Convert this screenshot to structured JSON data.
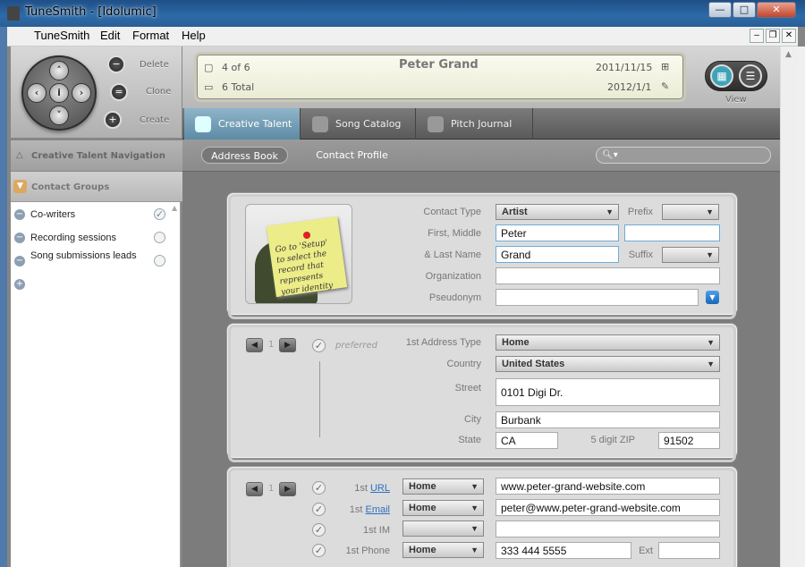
{
  "window": {
    "title": "TuneSmith - [Idolumic]",
    "minimize": "—",
    "maximize": "□",
    "close": "✕"
  },
  "menu": {
    "items": [
      "TuneSmith",
      "Edit",
      "Format",
      "Help"
    ]
  },
  "toolbar": {
    "delete": "Delete",
    "clone": "Clone",
    "create": "Create",
    "view": "View"
  },
  "record_header": {
    "position": "4 of 6",
    "total": "6 Total",
    "name": "Peter Grand",
    "date_created": "2011/11/15",
    "date_modified": "2012/1/1"
  },
  "tabs": [
    {
      "label": "Creative Talent",
      "active": true
    },
    {
      "label": "Song Catalog",
      "active": false
    },
    {
      "label": "Pitch Journal",
      "active": false
    }
  ],
  "left_panel": {
    "navigation_title": "Creative Talent Navigation",
    "groups_title": "Contact Groups",
    "groups": [
      {
        "label": "Co-writers",
        "checked": true
      },
      {
        "label": "Recording sessions",
        "checked": false
      },
      {
        "label": "Song submissions leads",
        "checked": false
      }
    ]
  },
  "subnav": {
    "address_book": "Address Book",
    "contact_profile": "Contact Profile",
    "search_placeholder": ""
  },
  "contact": {
    "photo_note": "Go to 'Setup' to select the record that represents your identity",
    "labels": {
      "contact_type": "Contact Type",
      "first_middle": "First, Middle",
      "last_name": "& Last Name",
      "organization": "Organization",
      "pseudonym": "Pseudonym",
      "prefix": "Prefix",
      "suffix": "Suffix"
    },
    "contact_type": "Artist",
    "first": "Peter",
    "middle": "",
    "last": "Grand",
    "organization": "",
    "pseudonym": ""
  },
  "address": {
    "index": "1",
    "preferred_label": "preferred",
    "labels": {
      "type": "1st Address Type",
      "country": "Country",
      "street": "Street",
      "city": "City",
      "state": "State",
      "zip": "5 digit ZIP"
    },
    "type": "Home",
    "country": "United States",
    "street": "0101 Digi Dr.",
    "city": "Burbank",
    "state": "CA",
    "zip": "91502"
  },
  "contacts": {
    "index": "1",
    "url_prefix": "1st",
    "url_label": "URL",
    "url_type": "Home",
    "url": "www.peter-grand-website.com",
    "email_prefix": "1st",
    "email_label": "Email",
    "email_type": "Home",
    "email": "peter@www.peter-grand-website.com",
    "im_label": "1st IM",
    "im_type": "",
    "im": "",
    "phone_label": "1st Phone",
    "phone_type": "Home",
    "phone": "333 444 5555",
    "ext_label": "Ext",
    "ext": ""
  }
}
